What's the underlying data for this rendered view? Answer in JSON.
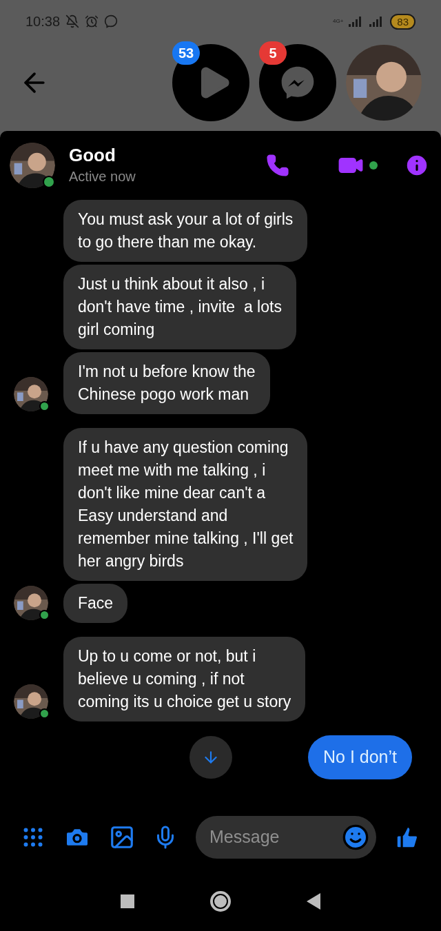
{
  "status_bar": {
    "time": "10:38",
    "network": "4G+",
    "battery": "83"
  },
  "chat_heads": [
    {
      "badge": "53",
      "color": "#1877f2",
      "kind": "video"
    },
    {
      "badge": "5",
      "color": "#e53935",
      "kind": "messenger"
    },
    {
      "kind": "avatar"
    }
  ],
  "contact": {
    "name": "Good",
    "status": "Active now",
    "online": true
  },
  "groups": [
    {
      "online": true,
      "messages": [
        {
          "lines": [
            "You must ask your a lot of girls",
            "to go there than me okay."
          ]
        },
        {
          "lines": [
            "Just u think about it also , i",
            "don't have time , invite  a lots",
            "girl coming"
          ]
        },
        {
          "lines": [
            "I'm not u before know the",
            "Chinese pogo work man"
          ]
        }
      ]
    },
    {
      "online": true,
      "messages": [
        {
          "lines": [
            "If u have any question coming",
            "meet me with me talking , i",
            "don't like mine dear can't a",
            "Easy understand and",
            "remember mine talking , I'll get",
            "her angry birds"
          ]
        },
        {
          "lines": [
            "Face"
          ]
        }
      ]
    },
    {
      "online": true,
      "messages": [
        {
          "lines": [
            "Up to u come or not, but i",
            "believe u coming , if not",
            "coming its u choice get u story"
          ]
        }
      ]
    }
  ],
  "sent": [
    {
      "text": "No I don’t"
    }
  ],
  "composer": {
    "placeholder": "Message"
  }
}
